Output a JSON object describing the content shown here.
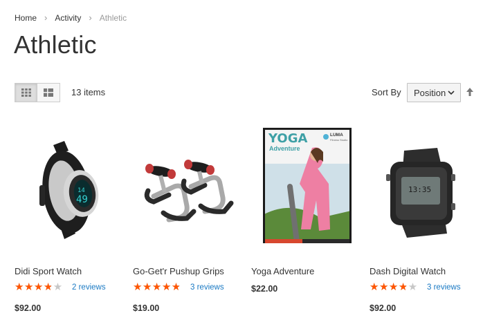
{
  "breadcrumb": {
    "items": [
      {
        "label": "Home"
      },
      {
        "label": "Activity"
      },
      {
        "label": "Athletic"
      }
    ]
  },
  "page": {
    "title": "Athletic"
  },
  "toolbar": {
    "modes": [
      {
        "name": "grid",
        "active": true
      },
      {
        "name": "list",
        "active": false
      }
    ],
    "item_count": "13 items",
    "sort_label": "Sort By",
    "sort_value": "Position",
    "sort_direction": "ascending"
  },
  "products": [
    {
      "name": "Didi Sport Watch",
      "rating": 3.5,
      "reviews": "2 reviews",
      "price": "$92.00"
    },
    {
      "name": "Go-Get'r Pushup Grips",
      "rating": 4.5,
      "reviews": "3 reviews",
      "price": "$19.00"
    },
    {
      "name": "Yoga Adventure",
      "rating": null,
      "reviews": "",
      "price": "$22.00",
      "dvd": {
        "title": "YOGA",
        "subtitle": "Adventure",
        "brand": "LUMA",
        "brand_sub": "Fitness Studio"
      }
    },
    {
      "name": "Dash Digital Watch",
      "rating": 3.5,
      "reviews": "3 reviews",
      "price": "$92.00"
    }
  ],
  "colors": {
    "star": "#ff5501",
    "link": "#1979c3"
  }
}
